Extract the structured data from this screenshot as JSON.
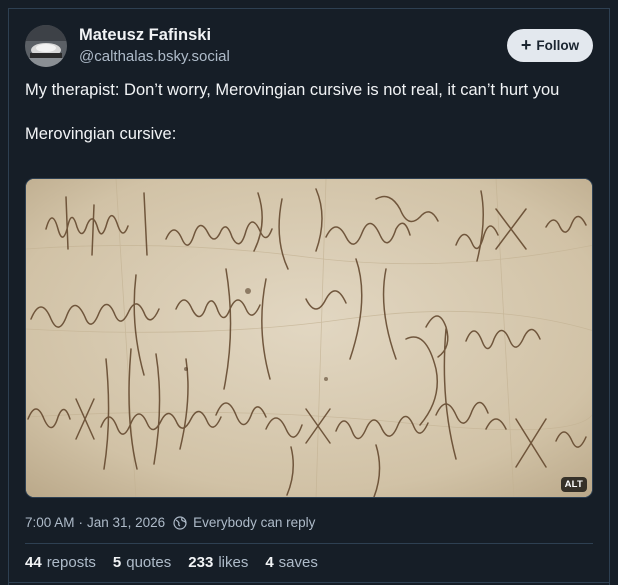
{
  "author": {
    "name": "Mateusz Fafinski",
    "handle": "@calthalas.bsky.social"
  },
  "follow_button": {
    "label": "Follow",
    "icon": "plus-icon"
  },
  "post": {
    "text_line1": "My therapist: Don’t worry, Merovingian cursive is not real, it can’t hurt you",
    "text_line2": "Merovingian cursive:",
    "image": {
      "alt_badge": "ALT",
      "content": "parchment-with-merovingian-cursive-script"
    }
  },
  "meta": {
    "time": "7:00 AM",
    "separator": "·",
    "date": "Jan 31, 2026",
    "reply_setting": "Everybody can reply",
    "reply_icon": "globe-icon"
  },
  "stats": [
    {
      "count": "44",
      "label": "reposts"
    },
    {
      "count": "5",
      "label": "quotes"
    },
    {
      "count": "233",
      "label": "likes"
    },
    {
      "count": "4",
      "label": "saves"
    }
  ],
  "colors": {
    "background": "#161e27",
    "border": "#2e4052",
    "text": "#f1f3f5",
    "muted": "#aebbc9",
    "follow_bg": "#e3e8ee"
  }
}
